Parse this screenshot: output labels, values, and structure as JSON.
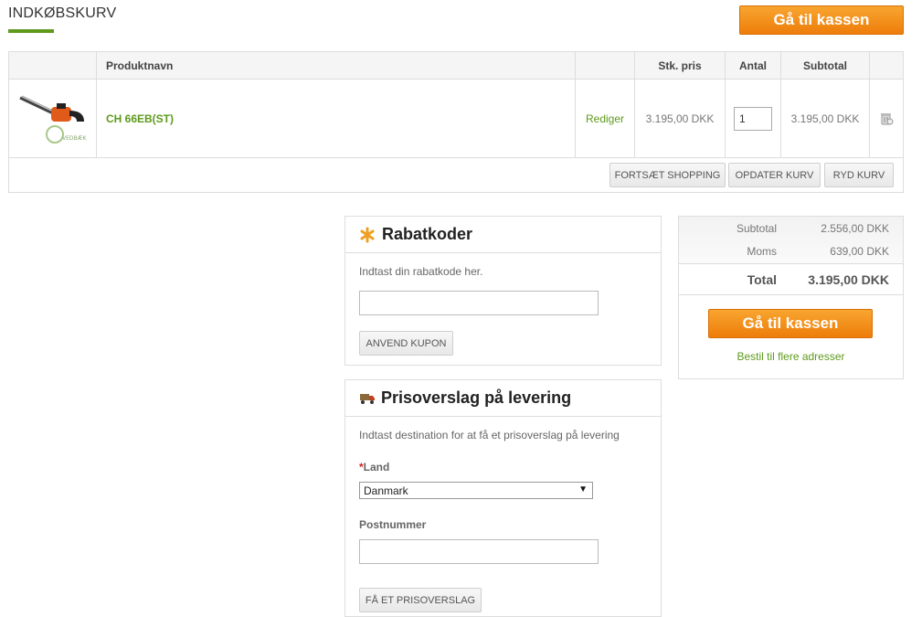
{
  "page": {
    "title": "INDKØBSKURV",
    "checkout_label": "Gå til kassen"
  },
  "cart": {
    "headers": {
      "name": "Produktnavn",
      "price": "Stk. pris",
      "qty": "Antal",
      "subtotal": "Subtotal"
    },
    "item": {
      "name": "CH 66EB(ST)",
      "edit_label": "Rediger",
      "unit_price": "3.195,00 DKK",
      "qty": "1",
      "subtotal": "3.195,00 DKK"
    },
    "actions": {
      "continue": "FORTSÆT SHOPPING",
      "update": "OPDATER KURV",
      "clear": "RYD KURV"
    }
  },
  "discount": {
    "title": "Rabatkoder",
    "hint": "Indtast din rabatkode her.",
    "code_value": "",
    "apply_label": "ANVEND KUPON"
  },
  "shipping": {
    "title": "Prisoverslag på levering",
    "hint": "Indtast destination for at få et prisoverslag på levering",
    "country_label": "Land",
    "required_mark": "*",
    "country_value": "Danmark",
    "postcode_label": "Postnummer",
    "postcode_value": "",
    "quote_label": "FÅ ET PRISOVERSLAG"
  },
  "totals": {
    "subtotal_label": "Subtotal",
    "subtotal_value": "2.556,00 DKK",
    "tax_label": "Moms",
    "tax_value": "639,00 DKK",
    "grand_label": "Total",
    "grand_value": "3.195,00 DKK",
    "checkout_label": "Gå til kassen",
    "multi_address_label": "Bestil til flere adresser"
  },
  "colors": {
    "accent_green": "#5e9a1c",
    "button_orange": "#f08a15"
  }
}
